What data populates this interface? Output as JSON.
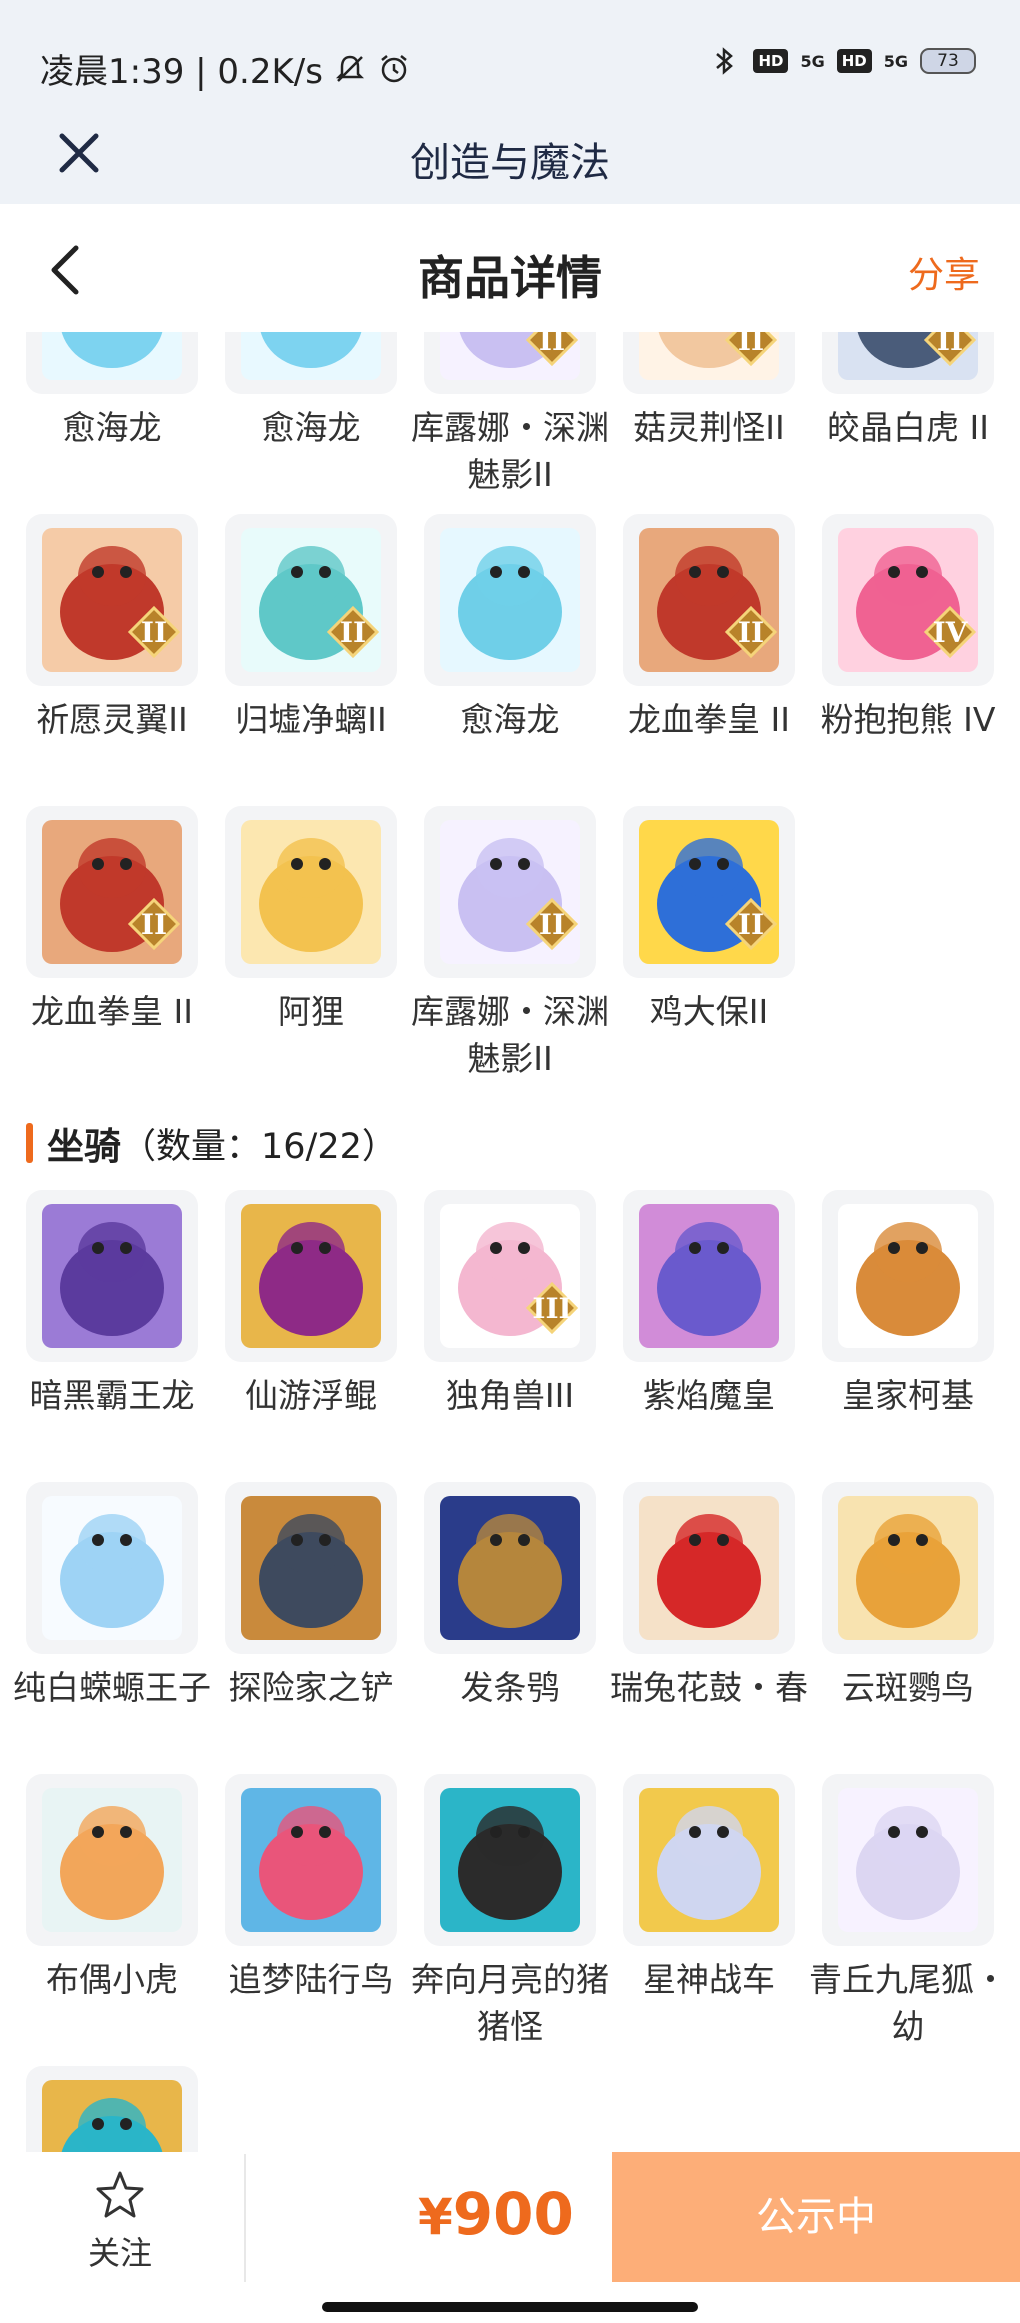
{
  "status_bar": {
    "time_speed": "凌晨1:39 | 0.2K/s",
    "hd1": "HD",
    "sig1": "5G",
    "hd2": "HD",
    "sig2": "5G",
    "battery": "73"
  },
  "app_bar": {
    "title": "创造与魔法"
  },
  "nav_bar": {
    "title": "商品详情",
    "share": "分享"
  },
  "pets": {
    "rows": [
      [
        "愈海龙",
        "愈海龙",
        "库露娜・深渊魅影II",
        "菇灵荆怪II",
        "皎晶白虎 II"
      ],
      [
        "祈愿灵翼II",
        "归墟净螭II",
        "愈海龙",
        "龙血拳皇 II",
        "粉抱抱熊 IV"
      ],
      [
        "龙血拳皇 II",
        "阿狸",
        "库露娜・深渊魅影II",
        "鸡大保II"
      ]
    ],
    "badges": [
      [
        "",
        "",
        "II",
        "II",
        "II"
      ],
      [
        "II",
        "II",
        "",
        "II",
        "IV"
      ],
      [
        "II",
        "",
        "II",
        "II"
      ]
    ]
  },
  "mounts": {
    "name": "坐骑",
    "count": "（数量：16/22）",
    "rows": [
      [
        "暗黑霸王龙",
        "仙游浮鲲",
        "独角兽III",
        "紫焰魔皇",
        "皇家柯基"
      ],
      [
        "纯白蝾螈王子",
        "探险家之铲",
        "发条鸮",
        "瑞兔花鼓・春",
        "云斑鹦鸟"
      ],
      [
        "布偶小虎",
        "追梦陆行鸟",
        "奔向月亮的猪猪怪",
        "星神战车",
        "青丘九尾狐・幼"
      ],
      [
        ""
      ]
    ],
    "badges": [
      [
        "",
        "",
        "III",
        "",
        ""
      ]
    ]
  },
  "bottom_bar": {
    "follow": "关注",
    "currency": "¥",
    "price": "900",
    "status": "公示中"
  },
  "colors": {
    "accent": "#ee6a1d",
    "button": "#fdae78",
    "header_bg": "#eef2f7",
    "tile_bg": "#f3f4f6"
  }
}
